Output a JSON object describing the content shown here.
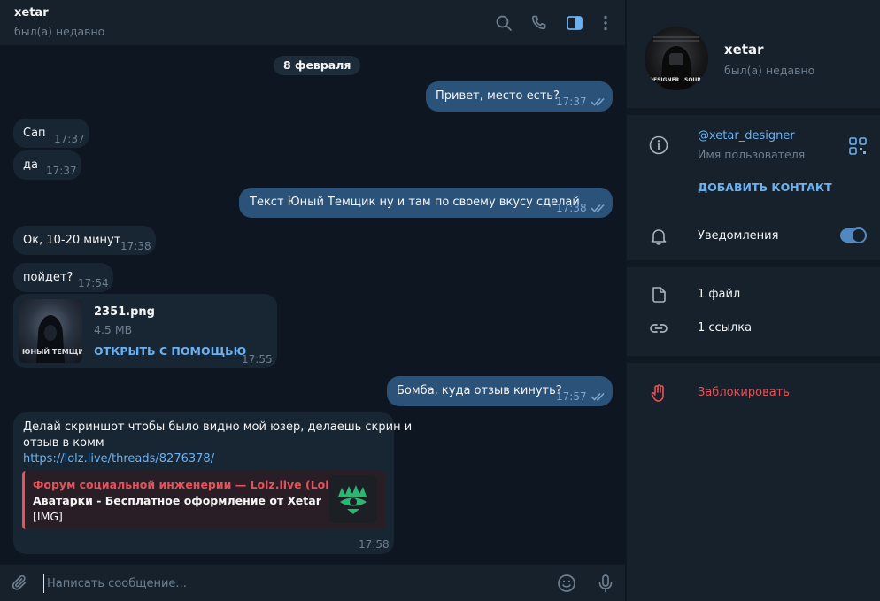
{
  "header": {
    "title": "xetar",
    "status": "был(а) недавно"
  },
  "date_separator": "8 февраля",
  "messages": [
    {
      "direction": "out",
      "text": "Привет, место есть?",
      "time": "17:37",
      "read": true
    },
    {
      "direction": "in",
      "text": "Сап",
      "time": "17:37"
    },
    {
      "direction": "in",
      "text": "да",
      "time": "17:37"
    },
    {
      "direction": "out",
      "text": "Текст Юный Темщик ну и там по своему вкусу сделай",
      "time": "17:38",
      "read": true
    },
    {
      "direction": "in",
      "text": "Ок, 10-20 минут",
      "time": "17:38"
    },
    {
      "direction": "in",
      "text": "пойдет?",
      "time": "17:54"
    },
    {
      "direction": "in",
      "type": "file",
      "file_name": "2351.png",
      "file_size": "4.5 MB",
      "open_label": "ОТКРЫТЬ С ПОМОЩЬЮ",
      "thumb_text": "ЮНЫЙ ТЕМЩИК",
      "time": "17:55"
    },
    {
      "direction": "out",
      "text": "Бомба, куда отзыв кинуть?",
      "time": "17:57",
      "read": true
    },
    {
      "direction": "in",
      "text_line1": "Делай скриншот чтобы было видно мой юзер, делаешь скрин и",
      "text_line2": "отзыв в комм",
      "link": "https://lolz.live/threads/8276378/",
      "preview": {
        "site": "Форум социальной инженерии —  Lolz.live (Lolzt...",
        "title": "Аватарки - Бесплатное оформление от Xetar",
        "desc": "[IMG]"
      },
      "time": "17:58"
    }
  ],
  "composer": {
    "placeholder": "Написать сообщение..."
  },
  "profile": {
    "name": "xetar",
    "status": "был(а) недавно",
    "avatar_text_left": "DESIGNER",
    "avatar_text_right": "SOURI",
    "username": "@xetar_designer",
    "username_label": "Имя пользователя",
    "add_contact": "ДОБАВИТЬ КОНТАКТ",
    "notifications_label": "Уведомления",
    "notifications_on": true,
    "files_label": "1 файл",
    "links_label": "1 ссылка",
    "block_label": "Заблокировать"
  },
  "icons": [
    "search-icon",
    "phone-icon",
    "sidebar-toggle-icon",
    "more-icon",
    "attach-icon",
    "emoji-icon",
    "mic-icon",
    "info-icon",
    "qr-icon",
    "bell-icon",
    "file-icon",
    "link-icon",
    "block-hand-icon"
  ],
  "colors": {
    "background": "#0e1621",
    "panel": "#17212b",
    "incoming_bubble": "#182533",
    "outgoing_bubble": "#2b5278",
    "accent": "#6ab2f2",
    "danger": "#e5535a"
  }
}
